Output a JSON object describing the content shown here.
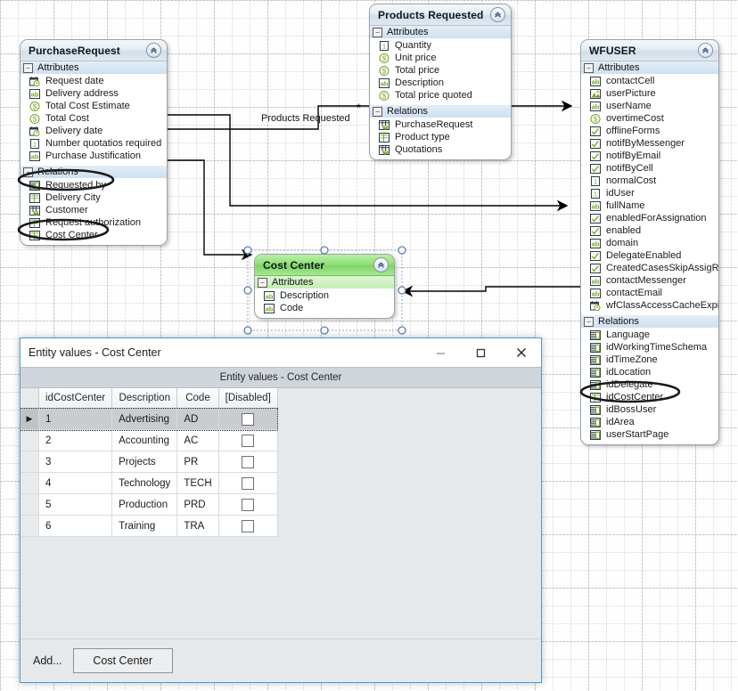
{
  "canvas": {
    "connector_label": "Products Requested",
    "multiplicity_marker": "*"
  },
  "entities": [
    {
      "id": "purchase-request",
      "title": "PurchaseRequest",
      "selected": false,
      "sections": [
        {
          "label": "Attributes",
          "rows": [
            {
              "icon": "date-icon",
              "name": "Request date"
            },
            {
              "icon": "text-icon",
              "name": "Delivery address"
            },
            {
              "icon": "money-icon",
              "name": "Total Cost Estimate"
            },
            {
              "icon": "money-icon",
              "name": "Total Cost"
            },
            {
              "icon": "date-icon",
              "name": "Delivery date"
            },
            {
              "icon": "number-icon",
              "name": "Number quotatios required"
            },
            {
              "icon": "text-icon",
              "name": "Purchase Justification"
            }
          ]
        },
        {
          "label": "Relations",
          "rows": [
            {
              "icon": "relation-entity-icon",
              "name": "Requested by",
              "highlighted": true
            },
            {
              "icon": "relation-table-icon",
              "name": "Delivery City"
            },
            {
              "icon": "relation-multi-icon",
              "name": "Customer"
            },
            {
              "icon": "relation-table-icon",
              "name": "Request authorization"
            },
            {
              "icon": "relation-table-icon",
              "name": "Cost Center",
              "highlighted": true
            }
          ]
        }
      ]
    },
    {
      "id": "products-requested",
      "title": "Products Requested",
      "selected": false,
      "sections": [
        {
          "label": "Attributes",
          "rows": [
            {
              "icon": "number-icon",
              "name": "Quantity"
            },
            {
              "icon": "money-icon",
              "name": "Unit price"
            },
            {
              "icon": "money-icon",
              "name": "Total price"
            },
            {
              "icon": "text-icon",
              "name": "Description"
            },
            {
              "icon": "money-icon",
              "name": "Total price quoted"
            }
          ]
        },
        {
          "label": "Relations",
          "rows": [
            {
              "icon": "relation-multi-icon",
              "name": "PurchaseRequest"
            },
            {
              "icon": "relation-table-icon",
              "name": "Product type"
            },
            {
              "icon": "relation-multi-icon",
              "name": "Quotations"
            }
          ]
        }
      ]
    },
    {
      "id": "cost-center",
      "title": "Cost Center",
      "selected": true,
      "sections": [
        {
          "label": "Attributes",
          "rows": [
            {
              "icon": "text-icon",
              "name": "Description"
            },
            {
              "icon": "text-icon",
              "name": "Code"
            }
          ]
        }
      ]
    },
    {
      "id": "wfuser",
      "title": "WFUSER",
      "selected": false,
      "sections": [
        {
          "label": "Attributes",
          "rows": [
            {
              "icon": "text-icon",
              "name": "contactCell"
            },
            {
              "icon": "image-icon",
              "name": "userPicture"
            },
            {
              "icon": "text-icon",
              "name": "userName"
            },
            {
              "icon": "money-icon",
              "name": "overtimeCost"
            },
            {
              "icon": "check-icon",
              "name": "offlineForms"
            },
            {
              "icon": "check-icon",
              "name": "notifByMessenger"
            },
            {
              "icon": "check-icon",
              "name": "notifByEmail"
            },
            {
              "icon": "check-icon",
              "name": "notifByCell"
            },
            {
              "icon": "number-icon",
              "name": "normalCost"
            },
            {
              "icon": "number-icon",
              "name": "idUser"
            },
            {
              "icon": "text-icon",
              "name": "fullName"
            },
            {
              "icon": "check-icon",
              "name": "enabledForAssignation"
            },
            {
              "icon": "check-icon",
              "name": "enabled"
            },
            {
              "icon": "text-icon",
              "name": "domain"
            },
            {
              "icon": "check-icon",
              "name": "DelegateEnabled"
            },
            {
              "icon": "check-icon",
              "name": "CreatedCasesSkipAssigRules"
            },
            {
              "icon": "text-icon",
              "name": "contactMessenger"
            },
            {
              "icon": "text-icon",
              "name": "contactEmail"
            },
            {
              "icon": "date-icon",
              "name": "wfClassAccessCacheExpiry"
            }
          ]
        },
        {
          "label": "Relations",
          "rows": [
            {
              "icon": "relation-entity-icon",
              "name": "Language"
            },
            {
              "icon": "relation-entity-icon",
              "name": "idWorkingTimeSchema"
            },
            {
              "icon": "relation-entity-icon",
              "name": "idTimeZone"
            },
            {
              "icon": "relation-entity-icon",
              "name": "idLocation"
            },
            {
              "icon": "relation-entity-icon",
              "name": "idDelegate"
            },
            {
              "icon": "relation-table-icon",
              "name": "idCostCenter",
              "highlighted": true
            },
            {
              "icon": "relation-entity-icon",
              "name": "idBossUser"
            },
            {
              "icon": "relation-entity-icon",
              "name": "idArea"
            },
            {
              "icon": "relation-entity-icon",
              "name": "userStartPage"
            }
          ]
        }
      ]
    }
  ],
  "dialog": {
    "title": "Entity values - Cost Center",
    "panel_header": "Entity values - Cost Center",
    "window_buttons": {
      "minimize": "minimize-icon",
      "maximize": "maximize-icon",
      "close": "close-icon"
    },
    "grid": {
      "columns": [
        "idCostCenter",
        "Description",
        "Code",
        "[Disabled]"
      ],
      "rows": [
        {
          "idCostCenter": "1",
          "Description": "Advertising",
          "Code": "AD",
          "Disabled": false,
          "selected": true
        },
        {
          "idCostCenter": "2",
          "Description": "Accounting",
          "Code": "AC",
          "Disabled": false,
          "selected": false
        },
        {
          "idCostCenter": "3",
          "Description": "Projects",
          "Code": "PR",
          "Disabled": false,
          "selected": false
        },
        {
          "idCostCenter": "4",
          "Description": "Technology",
          "Code": "TECH",
          "Disabled": false,
          "selected": false
        },
        {
          "idCostCenter": "5",
          "Description": "Production",
          "Code": "PRD",
          "Disabled": false,
          "selected": false
        },
        {
          "idCostCenter": "6",
          "Description": "Training",
          "Code": "TRA",
          "Disabled": false,
          "selected": false
        }
      ]
    },
    "footer": {
      "add_label": "Add...",
      "entity_button": "Cost Center"
    }
  },
  "colors": {
    "selected_entity": "#8fe077",
    "header_blue": "#d3dee7",
    "dialog_border": "#4a9bd4",
    "icon_green": "#7aa92b"
  }
}
